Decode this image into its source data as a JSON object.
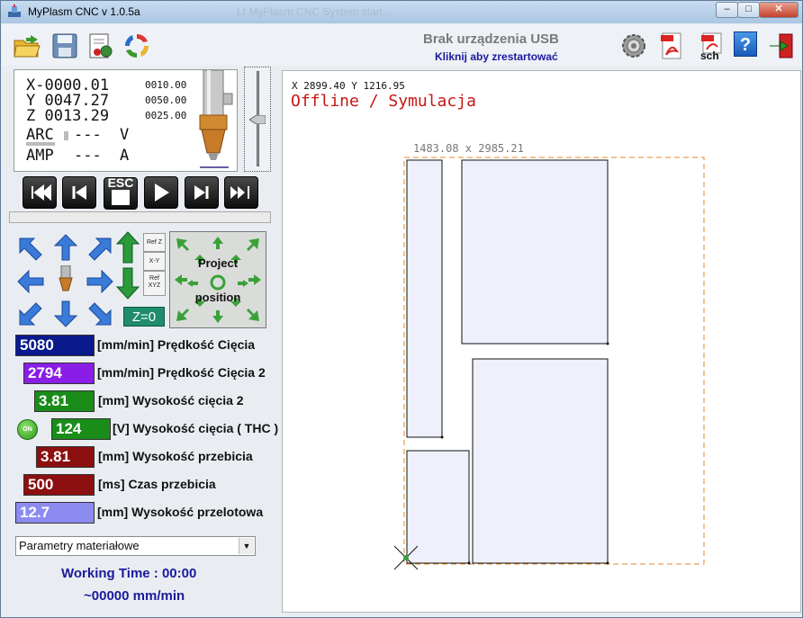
{
  "window": {
    "title": "MyPlasm CNC v 1.0.5a",
    "background_title": "Lt MyPlasm CNC  System stan..."
  },
  "toolbar": {
    "icons": [
      "open-folder-icon",
      "save-icon",
      "settings-document-icon",
      "refresh-icon"
    ],
    "device_status": "Brak urządzenia USB",
    "device_hint": "Kliknij aby zrestartować",
    "right_icons": [
      "gear-icon",
      "pdf-icon",
      "pdf-icon",
      "pdf-sch-icon",
      "help-icon",
      "exit-icon"
    ],
    "sch_label": "sch",
    "help_label": "?"
  },
  "dro": {
    "x": "X-0000.01",
    "y": "Y 0047.27",
    "z": "Z 0013.29",
    "x_small": "0010.00",
    "y_small": "0050.00",
    "z_small": "0025.00",
    "arc_label": "ARC",
    "arc_value": "---",
    "arc_unit": "V",
    "amp_label": "AMP",
    "amp_value": "---",
    "amp_unit": "A"
  },
  "media": {
    "esc_label": "ESC"
  },
  "jog": {
    "ref_z": "Ref Z",
    "x_y": "X-Y",
    "ref_xyz_1": "Ref",
    "ref_xyz_2": "XYZ",
    "z_zero": "Z=0",
    "project_line1": "Project",
    "project_line2": "position"
  },
  "params": [
    {
      "value": "5080",
      "label": "[mm/min] Prędkość Cięcia",
      "color": "#0a1a8c"
    },
    {
      "value": "2794",
      "label": "[mm/min] Prędkość Cięcia 2",
      "color": "#8a1ee6"
    },
    {
      "value": "3.81",
      "label": "[mm] Wysokość cięcia 2",
      "color": "#1a8c1a"
    },
    {
      "value": "124",
      "label": "[V] Wysokość cięcia ( THC )",
      "color": "#1a8c1a"
    },
    {
      "value": "3.81",
      "label": "[mm] Wysokość przebicia",
      "color": "#8c1010"
    },
    {
      "value": "500",
      "label": "[ms] Czas przebicia",
      "color": "#8c1010"
    },
    {
      "value": "12.7",
      "label": "[mm] Wysokość przelotowa",
      "color": "#8c8cf0"
    }
  ],
  "thc_toggle": "ON",
  "material_select": "Parametry materiałowe",
  "working_time": "Working Time : 00:00",
  "feed_rate": "~00000 mm/min",
  "canvas": {
    "coords": "X 2899.40  Y 1216.95",
    "mode": "Offline / Symulacja",
    "sheet_dims": "1483.08 x  2985.21"
  }
}
